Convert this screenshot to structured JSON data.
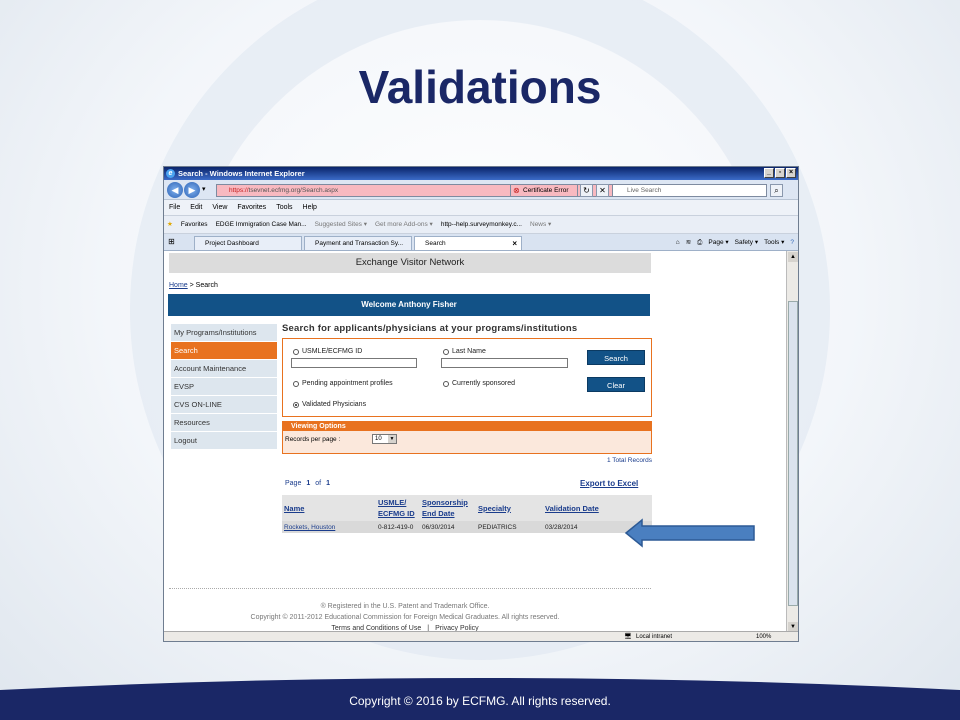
{
  "slide": {
    "title": "Validations",
    "footer": "Copyright © 2016 by ECFMG.  All rights reserved."
  },
  "browser": {
    "window_title": "Search - Windows Internet Explorer",
    "address_prefix": "https://",
    "address_rest": "tsevnet.ecfmg.org/Search.aspx",
    "cert_error": "Certificate Error",
    "live_search_placeholder": "Live Search",
    "menu": [
      "File",
      "Edit",
      "View",
      "Favorites",
      "Tools",
      "Help"
    ],
    "favorites_label": "Favorites",
    "favorites_items": [
      "EDGE Immigration Case Man...",
      "Suggested Sites ▾",
      "Get more Add-ons ▾",
      "http--help.surveymonkey.c...",
      "News ▾"
    ],
    "tabs": [
      "Project Dashboard",
      "Payment and Transaction Sy...",
      "Search"
    ],
    "commands": [
      "Page ▾",
      "Safety ▾",
      "Tools ▾"
    ],
    "status_zone": "Local intranet",
    "zoom": "100%"
  },
  "page": {
    "header": "Exchange Visitor Network",
    "breadcrumb_home": "Home",
    "breadcrumb_rest": " > Search",
    "welcome": "Welcome Anthony Fisher",
    "nav": [
      "My Programs/Institutions",
      "Search",
      "Account Maintenance",
      "EVSP",
      "CVS ON-LINE",
      "Resources",
      "Logout"
    ],
    "search_title": "Search for applicants/physicians at your programs/institutions",
    "options": {
      "usmle": "USMLE/ECFMG ID",
      "last_name": "Last Name",
      "pending": "Pending appointment profiles",
      "sponsored": "Currently sponsored",
      "validated": "Validated Physicians"
    },
    "search_button": "Search",
    "clear_button": "Clear",
    "viewing_options": "Viewing Options",
    "records_per_page_label": "Records per page :",
    "records_per_page_value": "10",
    "total_records": "1 Total Records",
    "pager": {
      "page_label": "Page",
      "current": "1",
      "of_label": "of",
      "total": "1"
    },
    "export": "Export to Excel",
    "columns": [
      "Name",
      "USMLE/ ECFMG ID",
      "Sponsorship End Date",
      "Specialty",
      "Validation Date"
    ],
    "rows": [
      [
        "Rockets, Houston",
        "0-812-419-0",
        "06/30/2014",
        "PEDIATRICS",
        "03/28/2014"
      ]
    ],
    "footer_line1": "® Registered in the U.S. Patent and Trademark Office.",
    "footer_line2": "Copyright © 2011-2012 Educational Commission for Foreign Medical Graduates. All rights reserved.",
    "footer_links": [
      "Terms and Conditions of Use",
      "|",
      "Privacy Policy"
    ]
  },
  "colors": {
    "title": "#1a2766",
    "header_blue": "#125287",
    "accent_orange": "#e8721f",
    "arrow": "#4a7fc0"
  }
}
